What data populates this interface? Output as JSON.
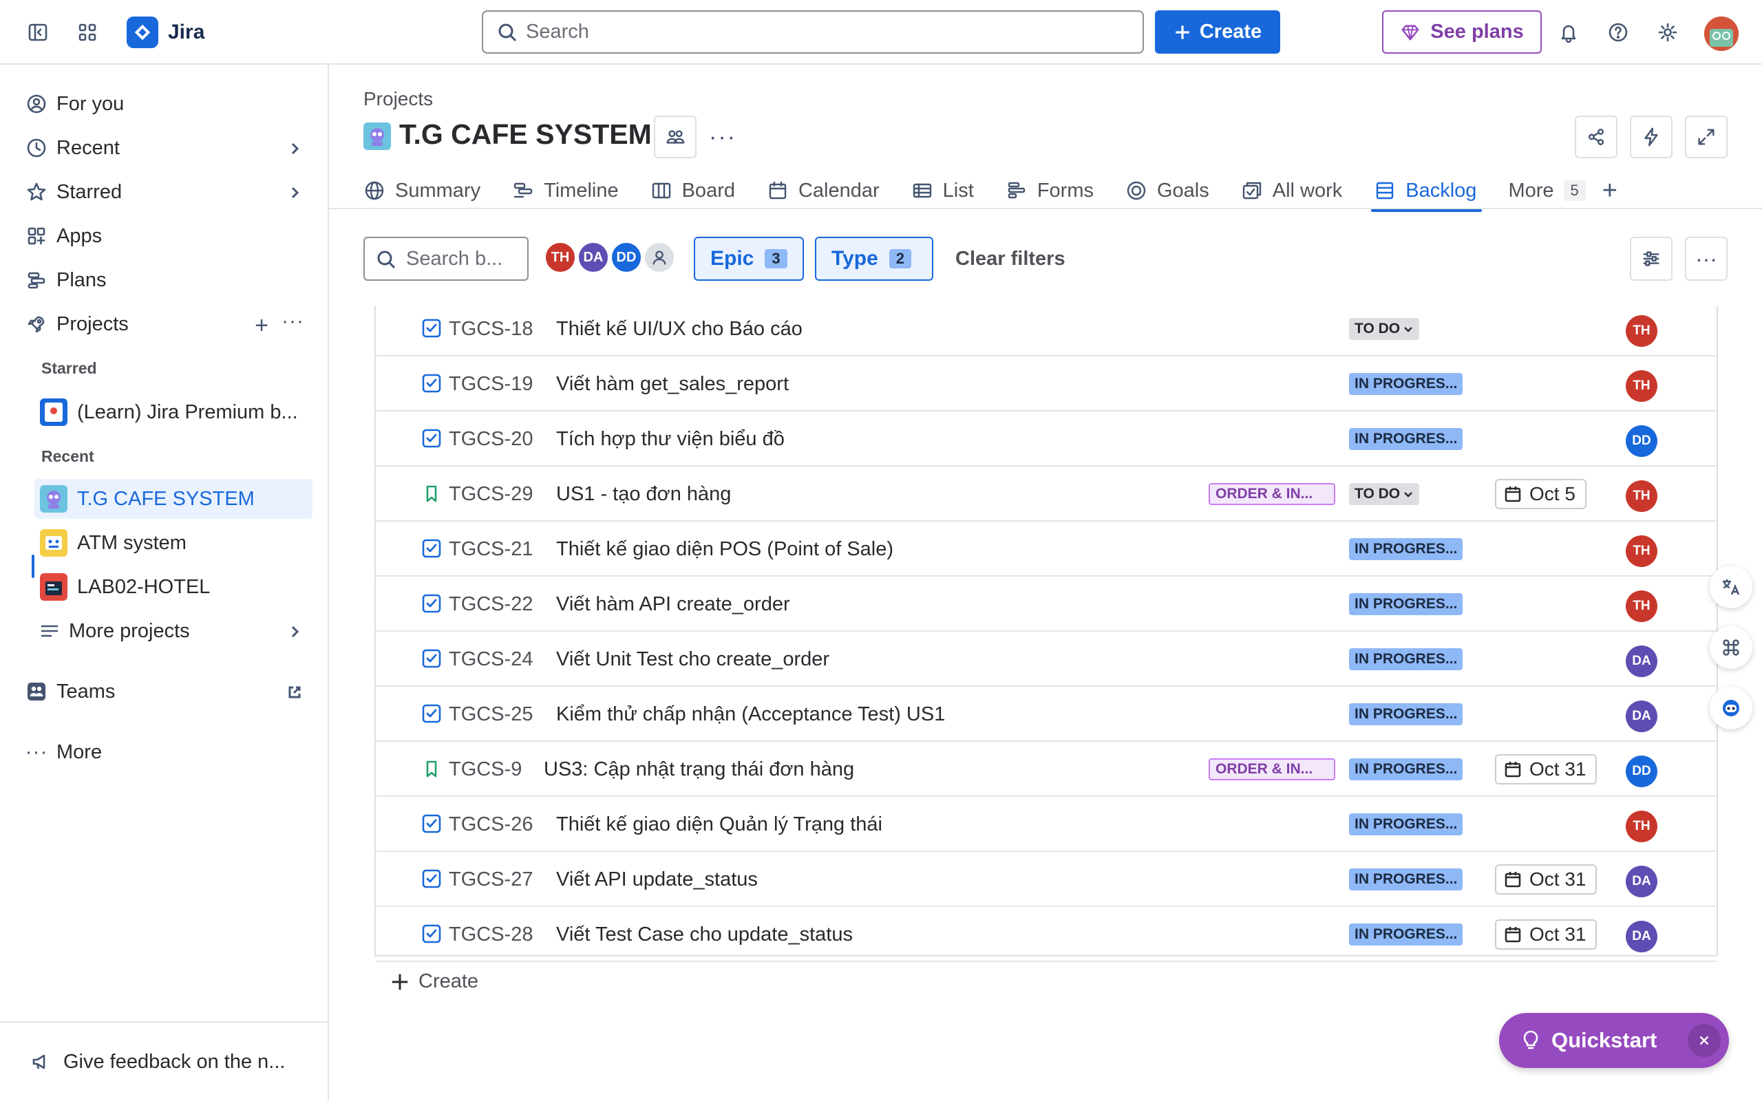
{
  "topbar": {
    "app_name": "Jira",
    "search_placeholder": "Search",
    "create_label": "Create",
    "see_plans_label": "See plans"
  },
  "sidebar": {
    "items": [
      {
        "label": "For you",
        "icon": "user-circle-icon"
      },
      {
        "label": "Recent",
        "icon": "clock-icon"
      },
      {
        "label": "Starred",
        "icon": "star-icon"
      },
      {
        "label": "Apps",
        "icon": "apps-icon"
      },
      {
        "label": "Plans",
        "icon": "plans-icon"
      },
      {
        "label": "Projects",
        "icon": "rocket-icon"
      }
    ],
    "starred_heading": "Starred",
    "starred_projects": [
      {
        "label": "(Learn) Jira Premium b..."
      }
    ],
    "recent_heading": "Recent",
    "recent_projects": [
      {
        "label": "T.G CAFE SYSTEM",
        "active": true,
        "color": "#6cc3e0"
      },
      {
        "label": "ATM system",
        "color": "#f5cd47"
      },
      {
        "label": "LAB02-HOTEL",
        "color": "#e2483d"
      }
    ],
    "more_projects": "More projects",
    "teams": "Teams",
    "more": "More",
    "feedback": "Give feedback on the n..."
  },
  "main": {
    "breadcrumb": "Projects",
    "project_title": "T.G CAFE SYSTEM",
    "tabs": [
      {
        "label": "Summary",
        "icon": "globe-icon"
      },
      {
        "label": "Timeline",
        "icon": "timeline-icon"
      },
      {
        "label": "Board",
        "icon": "board-icon"
      },
      {
        "label": "Calendar",
        "icon": "calendar-icon"
      },
      {
        "label": "List",
        "icon": "list-icon"
      },
      {
        "label": "Forms",
        "icon": "forms-icon"
      },
      {
        "label": "Goals",
        "icon": "goals-icon"
      },
      {
        "label": "All work",
        "icon": "all-work-icon"
      },
      {
        "label": "Backlog",
        "icon": "backlog-icon",
        "active": true
      },
      {
        "label": "More",
        "count": "5"
      }
    ],
    "filters": {
      "search_placeholder": "Search b...",
      "avatars": [
        "TH",
        "DA",
        "DD"
      ],
      "epic_label": "Epic",
      "epic_count": "3",
      "type_label": "Type",
      "type_count": "2",
      "clear_label": "Clear filters"
    },
    "issues": [
      {
        "type": "task",
        "key": "TGCS-18",
        "summary": "Thiết kế UI/UX cho Báo cáo",
        "status": "TO DO",
        "assignee": "TH"
      },
      {
        "type": "task",
        "key": "TGCS-19",
        "summary": "Viết hàm get_sales_report",
        "status": "IN PROGRES...",
        "assignee": "TH"
      },
      {
        "type": "task",
        "key": "TGCS-20",
        "summary": "Tích hợp thư viện biểu đồ",
        "status": "IN PROGRES...",
        "assignee": "DD"
      },
      {
        "type": "story",
        "key": "TGCS-29",
        "summary": "US1 - tạo đơn hàng",
        "epic": "ORDER & IN...",
        "status": "TO DO",
        "due": "Oct 5",
        "assignee": "TH"
      },
      {
        "type": "task",
        "key": "TGCS-21",
        "summary": "Thiết kế giao diện POS (Point of Sale)",
        "status": "IN PROGRES...",
        "assignee": "TH"
      },
      {
        "type": "task",
        "key": "TGCS-22",
        "summary": "Viết hàm API create_order",
        "status": "IN PROGRES...",
        "assignee": "TH"
      },
      {
        "type": "task",
        "key": "TGCS-24",
        "summary": "Viết Unit Test cho create_order",
        "status": "IN PROGRES...",
        "assignee": "DA"
      },
      {
        "type": "task",
        "key": "TGCS-25",
        "summary": "Kiểm thử chấp nhận (Acceptance Test) US1",
        "status": "IN PROGRES...",
        "assignee": "DA"
      },
      {
        "type": "story",
        "key": "TGCS-9",
        "summary": "US3: Cập nhật trạng thái đơn hàng",
        "epic": "ORDER & IN...",
        "status": "IN PROGRES...",
        "due": "Oct 31",
        "assignee": "DD"
      },
      {
        "type": "task",
        "key": "TGCS-26",
        "summary": "Thiết kế giao diện Quản lý Trạng thái",
        "status": "IN PROGRES...",
        "assignee": "TH"
      },
      {
        "type": "task",
        "key": "TGCS-27",
        "summary": "Viết API update_status",
        "status": "IN PROGRES...",
        "due": "Oct 31",
        "assignee": "DA"
      },
      {
        "type": "task",
        "key": "TGCS-28",
        "summary": "Viết Test Case cho update_status",
        "status": "IN PROGRES...",
        "due": "Oct 31",
        "assignee": "DA"
      }
    ],
    "create_label": "Create"
  },
  "quickstart": {
    "label": "Quickstart"
  },
  "colors": {
    "accent": "#1868db",
    "purple": "#964ac0",
    "avatar_TH": "#c9372c",
    "avatar_DA": "#5e4db2",
    "avatar_DD": "#1868db"
  }
}
